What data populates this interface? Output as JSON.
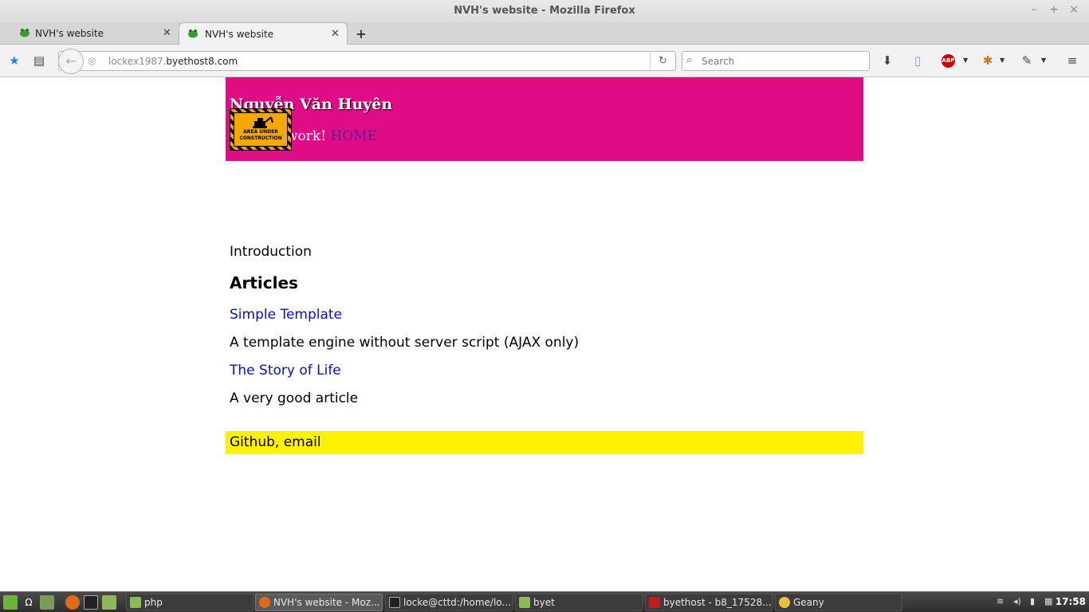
{
  "window": {
    "title": "NVH's website - Mozilla Firefox"
  },
  "tabs": [
    {
      "label": "NVH's website",
      "active": false
    },
    {
      "label": "NVH's website",
      "active": true
    }
  ],
  "navbar": {
    "url_host_prefix": "lockex1987.",
    "url_domain": "byethost8.com",
    "search_placeholder": "Search",
    "adblock_label": "ABP"
  },
  "page": {
    "site_title": "Nguyễn Văn Huyên",
    "tagline": "Make it work!",
    "home_link": "HOME",
    "construction_sign": "AREA UNDER CONSTRUCTION",
    "introduction": "Introduction",
    "articles_heading": "Articles",
    "articles": [
      {
        "title": "Simple Template",
        "description": "A template engine without server script (AJAX only)"
      },
      {
        "title": "The Story of Life",
        "description": "A very good article"
      }
    ],
    "footer": "Github, email"
  },
  "taskbar": {
    "tasks": [
      {
        "label": "php",
        "active": false
      },
      {
        "label": "NVH's website - Moz...",
        "active": true
      },
      {
        "label": "locke@cttd:/home/lo...",
        "active": false
      },
      {
        "label": "byet",
        "active": false
      },
      {
        "label": "byethost - b8_17528...",
        "active": false
      },
      {
        "label": "Geany",
        "active": false
      }
    ],
    "clock": "17:58"
  },
  "colors": {
    "header_bg": "#e00c85",
    "footer_bg": "#fff200",
    "link": "#0b0bd6",
    "home_link": "#5a1aa0"
  }
}
